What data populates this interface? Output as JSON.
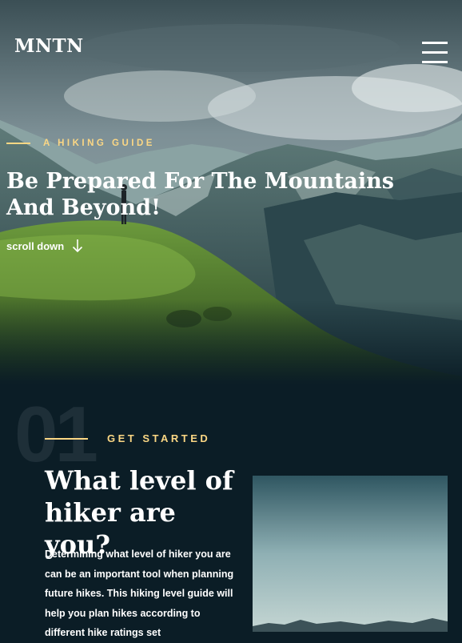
{
  "header": {
    "logo": "MNTN",
    "menu_icon": "hamburger-menu-icon"
  },
  "hero": {
    "eyebrow": "A HIKING GUIDE",
    "title": "Be Prepared For The Mountains And Beyond!",
    "scroll_label": "scroll down",
    "scroll_icon": "arrow-down-icon"
  },
  "section": {
    "number": "01",
    "eyebrow": "GET STARTED",
    "title": "What level of hiker are you?",
    "body": "Determining what level of hiker you are can be an important tool when planning future hikes. This hiking level guide will help you plan hikes according to different hike ratings set"
  },
  "colors": {
    "background": "#0b1d26",
    "accent": "#fbd784",
    "text": "#ffffff"
  }
}
